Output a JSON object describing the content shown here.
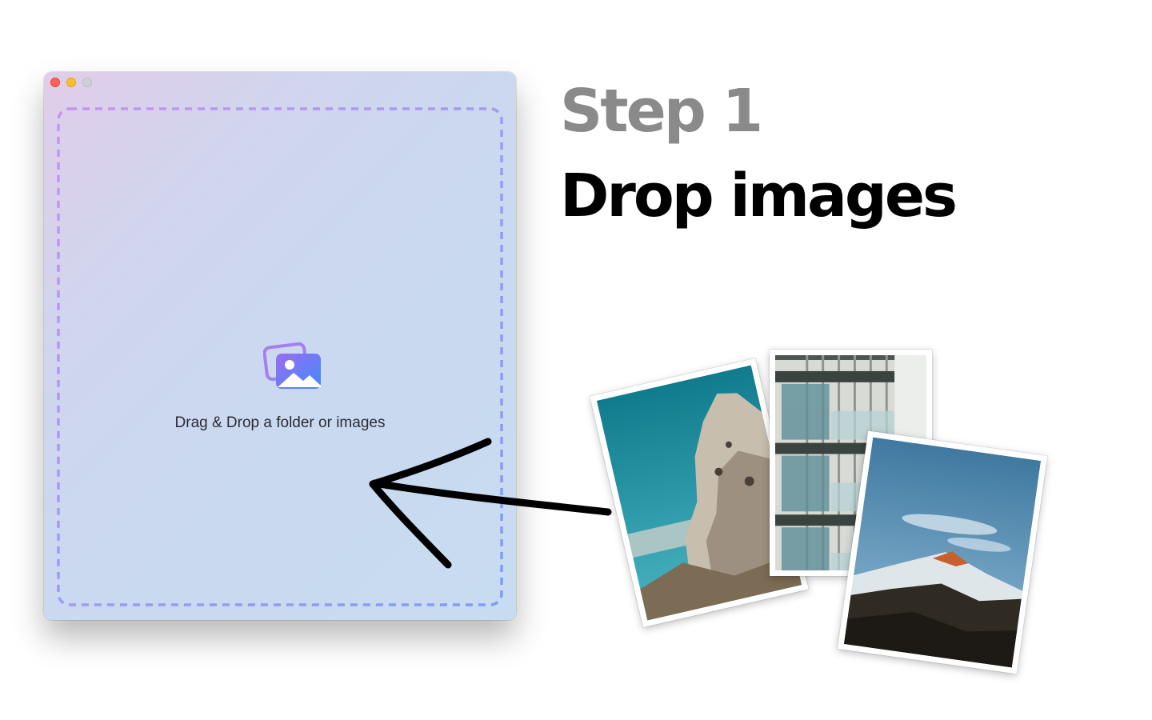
{
  "window": {
    "controls": [
      "close",
      "minimize",
      "zoom"
    ]
  },
  "drop_zone": {
    "icon": "photos-icon",
    "label": "Drag & Drop a folder or images"
  },
  "heading": {
    "step": "Step 1",
    "title": "Drop images"
  },
  "photos": [
    {
      "name": "rock-formation-photo"
    },
    {
      "name": "building-balconies-photo"
    },
    {
      "name": "snowy-mountain-photo"
    }
  ],
  "colors": {
    "dash_start": "#c397ee",
    "dash_end": "#7f9cf5",
    "icon_start": "#9b6cf2",
    "icon_end": "#3f8cf8",
    "step_gray": "#8a8a8a",
    "title_black": "#000000"
  }
}
